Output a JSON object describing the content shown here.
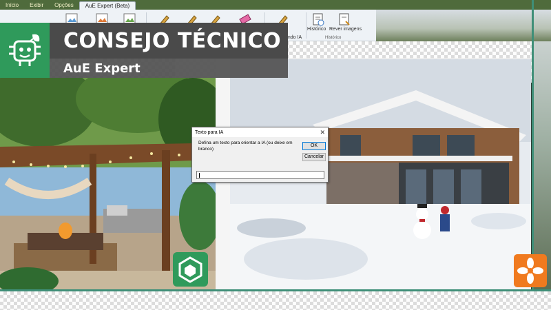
{
  "ribbon": {
    "tabs": [
      {
        "label": "Início"
      },
      {
        "label": "Exibir"
      },
      {
        "label": "Opções"
      },
      {
        "label": "AuE Expert (Beta)"
      }
    ],
    "buttons": {
      "prompt_partial": "ando IA",
      "history": "Histórico",
      "review_images": "Rever imagens"
    },
    "group_caption": "Histórico"
  },
  "banner": {
    "title": "CONSEJO TÉCNICO",
    "subtitle": "AuE Expert"
  },
  "dialog": {
    "title": "Texto para IA",
    "close": "✕",
    "message": "Defina um texto para orientar a IA (ou deixe em branco)",
    "ok_label": "OK",
    "cancel_label": "Cancelar",
    "input_value": ""
  },
  "colors": {
    "brand_green": "#2f9a5b",
    "brand_orange": "#f07a1f",
    "banner_dark": "#4a4a4a"
  },
  "icons": [
    "robot-chip-icon",
    "history-icon",
    "review-images-icon",
    "cube-logo-icon",
    "flower-logo-icon"
  ]
}
